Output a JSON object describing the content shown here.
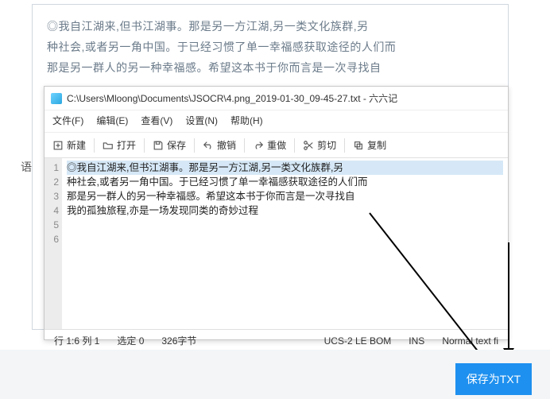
{
  "bg_lines": [
    "◎我自江湖来,但书江湖事。那是另一方江湖,另一类文化族群,另",
    "种社会,或者另一角中国。于已经习惯了单一幸福感获取途径的人们而",
    "那是另一群人的另一种幸福感。希望这本书于你而言是一次寻找自"
  ],
  "side_label": "语",
  "editor": {
    "title": "C:\\Users\\Mloong\\Documents\\JSOCR\\4.png_2019-01-30_09-45-27.txt - 六六记",
    "menu": [
      "文件(F)",
      "编辑(E)",
      "查看(V)",
      "设置(N)",
      "帮助(H)"
    ],
    "toolbar": {
      "new": "新建",
      "open": "打开",
      "save": "保存",
      "undo": "撤销",
      "redo": "重做",
      "cut": "剪切",
      "copy": "复制"
    },
    "lines": [
      "◎我自江湖来,但书江湖事。那是另一方江湖,另一类文化族群,另",
      "种社会,或者另一角中国。于已经习惯了单一幸福感获取途径的人们而",
      "那是另一群人的另一种幸福感。希望这本书于你而言是一次寻找自",
      "我的孤独旅程,亦是一场发现同类的奇妙过程"
    ],
    "status": {
      "pos": "行 1:6  列 1",
      "sel": "选定 0",
      "bytes": "326字节",
      "enc": "UCS-2 LE BOM",
      "mode": "INS",
      "lang": "Normal text fi"
    }
  },
  "save_button": "保存为TXT"
}
